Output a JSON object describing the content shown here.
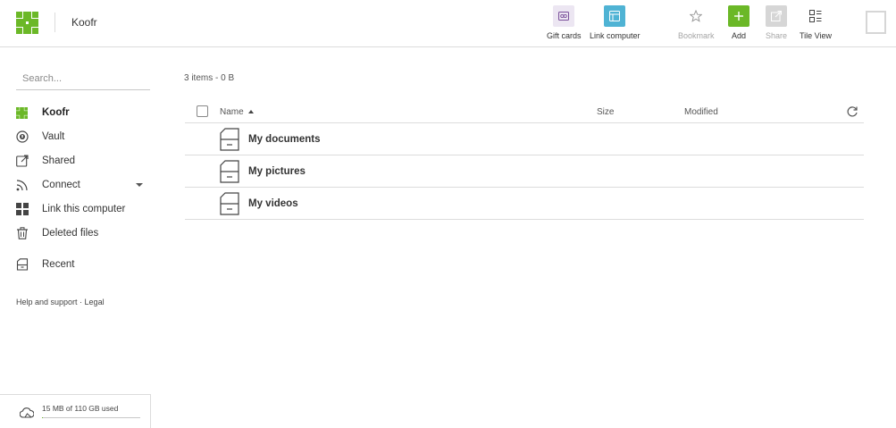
{
  "header": {
    "app_title": "Koofr",
    "tools": {
      "gift_cards": "Gift cards",
      "link_computer": "Link computer",
      "bookmark": "Bookmark",
      "add": "Add",
      "share": "Share",
      "tile_view": "Tile View"
    },
    "colors": {
      "brand_green": "#6bb827",
      "gift_bg": "#ece6f2",
      "link_bg": "#4fb3d4",
      "add_bg": "#6bb827",
      "share_bg": "#d6d6d6"
    }
  },
  "sidebar": {
    "search_placeholder": "Search...",
    "items": [
      {
        "label": "Koofr",
        "icon": "koofr-logo-icon"
      },
      {
        "label": "Vault",
        "icon": "vault-icon"
      },
      {
        "label": "Shared",
        "icon": "share-icon"
      },
      {
        "label": "Connect",
        "icon": "rss-icon"
      },
      {
        "label": "Link this computer",
        "icon": "grid-icon"
      },
      {
        "label": "Deleted files",
        "icon": "trash-icon"
      },
      {
        "label": "Recent",
        "icon": "recent-icon"
      }
    ],
    "help_link": "Help and support",
    "separator": " · ",
    "legal_link": "Legal",
    "storage_text": "15 MB of 110 GB used",
    "storage_used_fraction": 0.0001
  },
  "main": {
    "summary": "3 items - 0 B",
    "columns": {
      "name": "Name",
      "size": "Size",
      "modified": "Modified"
    },
    "files": [
      {
        "name": "My documents"
      },
      {
        "name": "My pictures"
      },
      {
        "name": "My videos"
      }
    ]
  }
}
